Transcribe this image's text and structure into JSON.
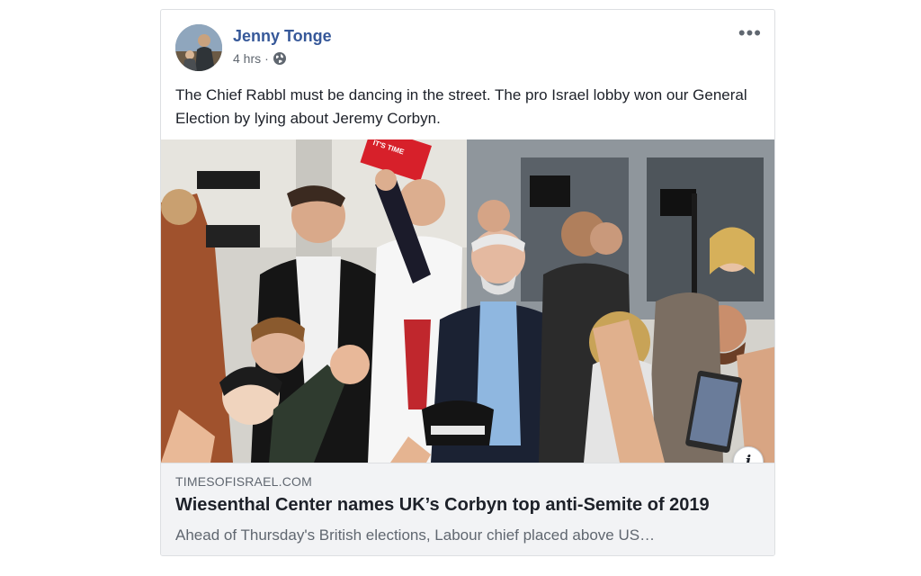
{
  "post": {
    "author": "Jenny Tonge",
    "time": "4 hrs",
    "separator": "·",
    "privacy_icon": "globe-icon",
    "more_icon": "more-options-icon",
    "more_label": "•••",
    "text": "The Chief Rabbl must be dancing in the street. The pro Israel lobby won our General Election by lying about Jeremy Corbyn."
  },
  "image": {
    "sign_text": "IT'S TIME FOR REAL CHANGE",
    "info_label": "i"
  },
  "link": {
    "domain": "TIMESOFISRAEL.COM",
    "headline": "Wiesenthal Center names UK’s Corbyn top anti-Semite of 2019",
    "description": "Ahead of Thursday's British elections, Labour chief placed above US…"
  },
  "colors": {
    "author": "#365899",
    "link_bg": "#f2f3f5",
    "sign": "#d7202a"
  }
}
